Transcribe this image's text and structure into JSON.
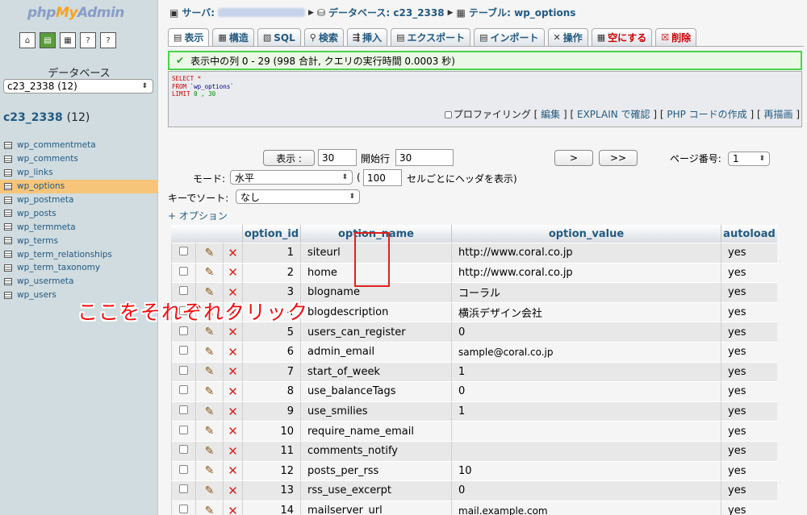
{
  "sidebar": {
    "logo_php": "php",
    "logo_my": "My",
    "logo_admin": "Admin",
    "db_label": "データベース",
    "db_select": "c23_2338 (12)",
    "db_name": "c23_2338",
    "db_count": "(12)",
    "tables": [
      "wp_commentmeta",
      "wp_comments",
      "wp_links",
      "wp_options",
      "wp_postmeta",
      "wp_posts",
      "wp_termmeta",
      "wp_terms",
      "wp_term_relationships",
      "wp_term_taxonomy",
      "wp_usermeta",
      "wp_users"
    ],
    "active_table": "wp_options"
  },
  "breadcrumb": {
    "server_label": "サーバ:",
    "database_label": "データベース: c23_2338",
    "table_label": "テーブル: wp_options"
  },
  "tabs": [
    "表示",
    "構造",
    "SQL",
    "検索",
    "挿入",
    "エクスポート",
    "インポート",
    "操作",
    "空にする",
    "削除"
  ],
  "success_msg": "表示中の列 0 - 29 (998 合計, クエリの実行時間 0.0003 秒)",
  "sql": {
    "line1": "SELECT *",
    "line2_kw": "FROM",
    "line2_tbl": "`wp_options`",
    "line3_kw": "LIMIT",
    "line3_val": "0 , 30"
  },
  "sql_links": {
    "profiling": "プロファイリング",
    "edit": "編集",
    "explain": "EXPLAIN で確認",
    "php": "PHP コードの作成",
    "refresh": "再描画"
  },
  "nav": {
    "show_btn": "表示 :",
    "rows_value": "30",
    "start_label": "開始行",
    "start_value": "30",
    "next_btn": ">",
    "last_btn": ">>",
    "page_label": "ページ番号:",
    "page_value": "1",
    "mode_label": "モード:",
    "mode_value": "水平",
    "paren_open": "(",
    "header_every_value": "100",
    "header_every_label": "セルごとにヘッダを表示)",
    "sort_label": "キーでソート:",
    "sort_value": "なし",
    "options_link": "+ オプション"
  },
  "table": {
    "headers": [
      "option_id",
      "option_name",
      "option_value",
      "autoload"
    ],
    "rows": [
      {
        "id": "1",
        "name": "siteurl",
        "value": "http://www.coral.co.jp",
        "autoload": "yes"
      },
      {
        "id": "2",
        "name": "home",
        "value": "http://www.coral.co.jp",
        "autoload": "yes"
      },
      {
        "id": "3",
        "name": "blogname",
        "value": "コーラル",
        "autoload": "yes"
      },
      {
        "id": "4",
        "name": "blogdescription",
        "value": "横浜デザイン会社",
        "autoload": "yes"
      },
      {
        "id": "5",
        "name": "users_can_register",
        "value": "0",
        "autoload": "yes"
      },
      {
        "id": "6",
        "name": "admin_email",
        "value": "sample@coral.co.jp",
        "autoload": "yes"
      },
      {
        "id": "7",
        "name": "start_of_week",
        "value": "1",
        "autoload": "yes"
      },
      {
        "id": "8",
        "name": "use_balanceTags",
        "value": "0",
        "autoload": "yes"
      },
      {
        "id": "9",
        "name": "use_smilies",
        "value": "1",
        "autoload": "yes"
      },
      {
        "id": "10",
        "name": "require_name_email",
        "value": "",
        "autoload": "yes"
      },
      {
        "id": "11",
        "name": "comments_notify",
        "value": "",
        "autoload": "yes"
      },
      {
        "id": "12",
        "name": "posts_per_rss",
        "value": "10",
        "autoload": "yes"
      },
      {
        "id": "13",
        "name": "rss_use_excerpt",
        "value": "0",
        "autoload": "yes"
      },
      {
        "id": "14",
        "name": "mailserver_url",
        "value": "mail.example.com",
        "autoload": "yes"
      }
    ]
  },
  "annotation": "ここをそれぞれクリック",
  "colors": {
    "accent": "#235a81",
    "highlight": "#f7c57a",
    "success_border": "#4ad34a",
    "annotation": "#ee1111"
  }
}
